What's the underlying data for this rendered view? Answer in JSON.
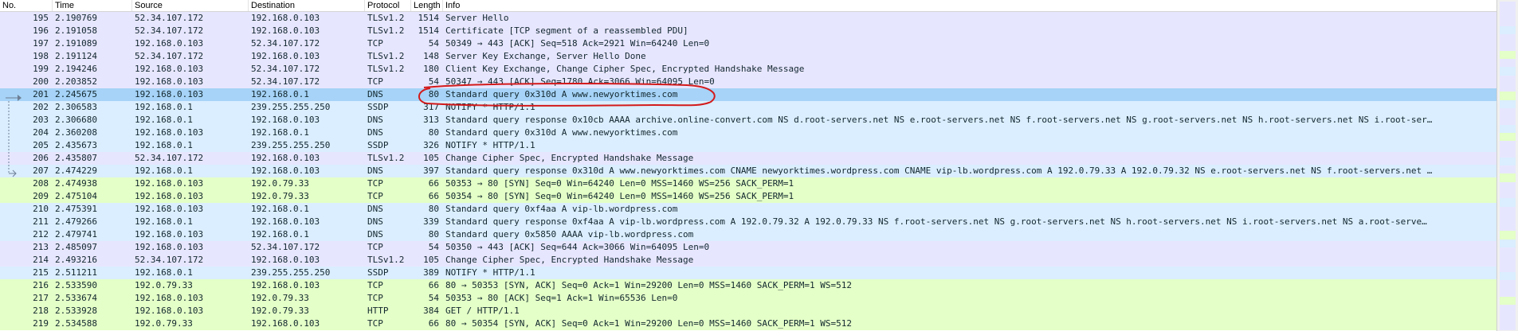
{
  "columns": [
    "No.",
    "Time",
    "Source",
    "Destination",
    "Protocol",
    "Length",
    "Info"
  ],
  "colors": {
    "tcp_row": "#e7e6ff",
    "udp_row": "#daeeff",
    "http_row": "#e4ffc7",
    "selected_row": "#a6d3f7",
    "annotation": "#d31a1a"
  },
  "packets": [
    {
      "no": "195",
      "time": "2.190769",
      "src": "52.34.107.172",
      "dst": "192.168.0.103",
      "proto": "TLSv1.2",
      "len": "1514",
      "info": "Server Hello",
      "color": "tcp"
    },
    {
      "no": "196",
      "time": "2.191058",
      "src": "52.34.107.172",
      "dst": "192.168.0.103",
      "proto": "TLSv1.2",
      "len": "1514",
      "info": "Certificate [TCP segment of a reassembled PDU]",
      "color": "tcp"
    },
    {
      "no": "197",
      "time": "2.191089",
      "src": "192.168.0.103",
      "dst": "52.34.107.172",
      "proto": "TCP",
      "len": "54",
      "info": "50349 → 443 [ACK] Seq=518 Ack=2921 Win=64240 Len=0",
      "color": "tcp"
    },
    {
      "no": "198",
      "time": "2.191124",
      "src": "52.34.107.172",
      "dst": "192.168.0.103",
      "proto": "TLSv1.2",
      "len": "148",
      "info": "Server Key Exchange, Server Hello Done",
      "color": "tcp"
    },
    {
      "no": "199",
      "time": "2.194246",
      "src": "192.168.0.103",
      "dst": "52.34.107.172",
      "proto": "TLSv1.2",
      "len": "180",
      "info": "Client Key Exchange, Change Cipher Spec, Encrypted Handshake Message",
      "color": "tcp"
    },
    {
      "no": "200",
      "time": "2.203852",
      "src": "192.168.0.103",
      "dst": "52.34.107.172",
      "proto": "TCP",
      "len": "54",
      "info": "50347 → 443 [ACK] Seq=1780 Ack=3066 Win=64095 Len=0",
      "color": "tcp"
    },
    {
      "no": "201",
      "time": "2.245675",
      "src": "192.168.0.103",
      "dst": "192.168.0.1",
      "proto": "DNS",
      "len": "80",
      "info": "Standard query 0x310d A www.newyorktimes.com",
      "color": "sel"
    },
    {
      "no": "202",
      "time": "2.306583",
      "src": "192.168.0.1",
      "dst": "239.255.255.250",
      "proto": "SSDP",
      "len": "317",
      "info": "NOTIFY * HTTP/1.1",
      "color": "udp"
    },
    {
      "no": "203",
      "time": "2.306680",
      "src": "192.168.0.1",
      "dst": "192.168.0.103",
      "proto": "DNS",
      "len": "313",
      "info": "Standard query response 0x10cb AAAA archive.online-convert.com NS d.root-servers.net NS e.root-servers.net NS f.root-servers.net NS g.root-servers.net NS h.root-servers.net NS i.root-ser…",
      "color": "udp"
    },
    {
      "no": "204",
      "time": "2.360208",
      "src": "192.168.0.103",
      "dst": "192.168.0.1",
      "proto": "DNS",
      "len": "80",
      "info": "Standard query 0x310d A www.newyorktimes.com",
      "color": "udp"
    },
    {
      "no": "205",
      "time": "2.435673",
      "src": "192.168.0.1",
      "dst": "239.255.255.250",
      "proto": "SSDP",
      "len": "326",
      "info": "NOTIFY * HTTP/1.1",
      "color": "udp"
    },
    {
      "no": "206",
      "time": "2.435807",
      "src": "52.34.107.172",
      "dst": "192.168.0.103",
      "proto": "TLSv1.2",
      "len": "105",
      "info": "Change Cipher Spec, Encrypted Handshake Message",
      "color": "tcp"
    },
    {
      "no": "207",
      "time": "2.474229",
      "src": "192.168.0.1",
      "dst": "192.168.0.103",
      "proto": "DNS",
      "len": "397",
      "info": "Standard query response 0x310d A www.newyorktimes.com CNAME newyorktimes.wordpress.com CNAME vip-lb.wordpress.com A 192.0.79.33 A 192.0.79.32 NS e.root-servers.net NS f.root-servers.net …",
      "color": "udp"
    },
    {
      "no": "208",
      "time": "2.474938",
      "src": "192.168.0.103",
      "dst": "192.0.79.33",
      "proto": "TCP",
      "len": "66",
      "info": "50353 → 80 [SYN] Seq=0 Win=64240 Len=0 MSS=1460 WS=256 SACK_PERM=1",
      "color": "http"
    },
    {
      "no": "209",
      "time": "2.475104",
      "src": "192.168.0.103",
      "dst": "192.0.79.33",
      "proto": "TCP",
      "len": "66",
      "info": "50354 → 80 [SYN] Seq=0 Win=64240 Len=0 MSS=1460 WS=256 SACK_PERM=1",
      "color": "http"
    },
    {
      "no": "210",
      "time": "2.475391",
      "src": "192.168.0.103",
      "dst": "192.168.0.1",
      "proto": "DNS",
      "len": "80",
      "info": "Standard query 0xf4aa A vip-lb.wordpress.com",
      "color": "udp"
    },
    {
      "no": "211",
      "time": "2.479266",
      "src": "192.168.0.1",
      "dst": "192.168.0.103",
      "proto": "DNS",
      "len": "339",
      "info": "Standard query response 0xf4aa A vip-lb.wordpress.com A 192.0.79.32 A 192.0.79.33 NS f.root-servers.net NS g.root-servers.net NS h.root-servers.net NS i.root-servers.net NS a.root-serve…",
      "color": "udp"
    },
    {
      "no": "212",
      "time": "2.479741",
      "src": "192.168.0.103",
      "dst": "192.168.0.1",
      "proto": "DNS",
      "len": "80",
      "info": "Standard query 0x5850 AAAA vip-lb.wordpress.com",
      "color": "udp"
    },
    {
      "no": "213",
      "time": "2.485097",
      "src": "192.168.0.103",
      "dst": "52.34.107.172",
      "proto": "TCP",
      "len": "54",
      "info": "50350 → 443 [ACK] Seq=644 Ack=3066 Win=64095 Len=0",
      "color": "tcp"
    },
    {
      "no": "214",
      "time": "2.493216",
      "src": "52.34.107.172",
      "dst": "192.168.0.103",
      "proto": "TLSv1.2",
      "len": "105",
      "info": "Change Cipher Spec, Encrypted Handshake Message",
      "color": "tcp"
    },
    {
      "no": "215",
      "time": "2.511211",
      "src": "192.168.0.1",
      "dst": "239.255.255.250",
      "proto": "SSDP",
      "len": "389",
      "info": "NOTIFY * HTTP/1.1",
      "color": "udp"
    },
    {
      "no": "216",
      "time": "2.533590",
      "src": "192.0.79.33",
      "dst": "192.168.0.103",
      "proto": "TCP",
      "len": "66",
      "info": "80 → 50353 [SYN, ACK] Seq=0 Ack=1 Win=29200 Len=0 MSS=1460 SACK_PERM=1 WS=512",
      "color": "http"
    },
    {
      "no": "217",
      "time": "2.533674",
      "src": "192.168.0.103",
      "dst": "192.0.79.33",
      "proto": "TCP",
      "len": "54",
      "info": "50353 → 80 [ACK] Seq=1 Ack=1 Win=65536 Len=0",
      "color": "http"
    },
    {
      "no": "218",
      "time": "2.533928",
      "src": "192.168.0.103",
      "dst": "192.0.79.33",
      "proto": "HTTP",
      "len": "384",
      "info": "GET / HTTP/1.1",
      "color": "http"
    },
    {
      "no": "219",
      "time": "2.534588",
      "src": "192.0.79.33",
      "dst": "192.168.0.103",
      "proto": "TCP",
      "len": "66",
      "info": "80 → 50354 [SYN, ACK] Seq=0 Ack=1 Win=29200 Len=0 MSS=1460 SACK_PERM=1 WS=512",
      "color": "http"
    }
  ],
  "minimap": [
    "tcp",
    "tcp",
    "tcp",
    "udp",
    "tcp",
    "tcp",
    "http",
    "tcp",
    "udp",
    "tcp",
    "tcp",
    "http",
    "udp",
    "tcp",
    "tcp",
    "udp",
    "http",
    "tcp",
    "tcp",
    "udp",
    "tcp",
    "http",
    "tcp",
    "tcp",
    "udp",
    "tcp",
    "tcp",
    "tcp",
    "http",
    "udp",
    "tcp",
    "tcp",
    "tcp",
    "udp",
    "tcp",
    "tcp",
    "http",
    "tcp",
    "tcp",
    "tcp"
  ]
}
